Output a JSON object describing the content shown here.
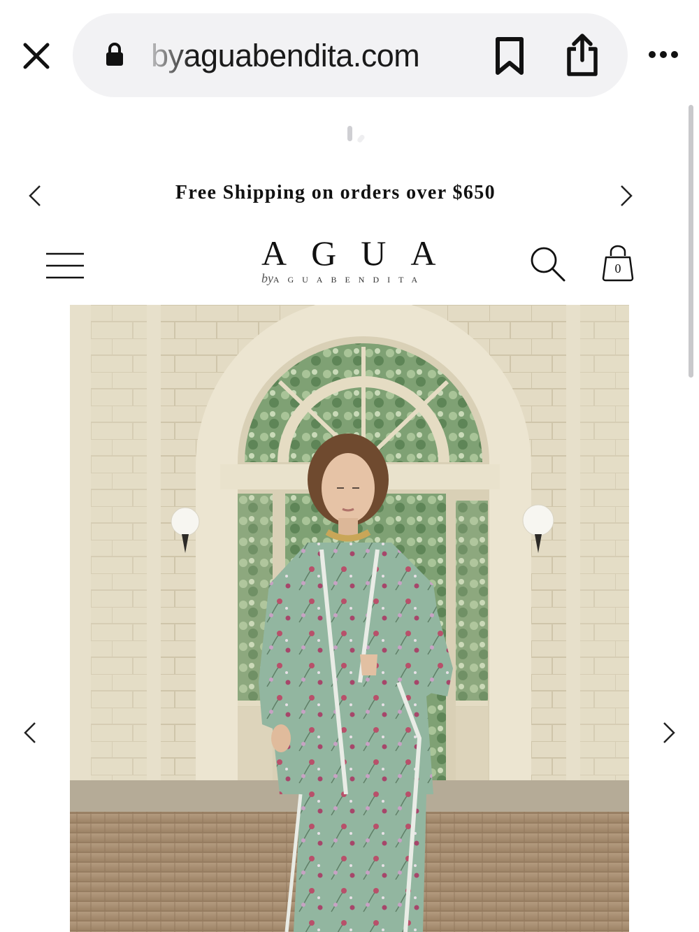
{
  "browser": {
    "url": "byaguabendita.com"
  },
  "announcement": {
    "text": "Free Shipping on orders over $650"
  },
  "header": {
    "logo_main": "AGUA",
    "logo_by": "by",
    "logo_sub": "AGUABENDITA",
    "cart_count": "0"
  },
  "hero": {
    "image": "model-in-green-floral-suit-under-arched-doorway"
  },
  "icons": {
    "close": "close-icon",
    "lock": "lock-icon",
    "bookmark": "bookmark-icon",
    "share": "share-icon",
    "more": "more-icon",
    "menu": "menu-icon",
    "search": "search-icon",
    "cart": "bag-icon",
    "prev": "chevron-left-icon",
    "next": "chevron-right-icon"
  },
  "colors": {
    "urlbar_bg": "#f2f2f4",
    "text": "#111111",
    "outfit_green": "#8fb39b",
    "stone": "#e4dcc6"
  }
}
